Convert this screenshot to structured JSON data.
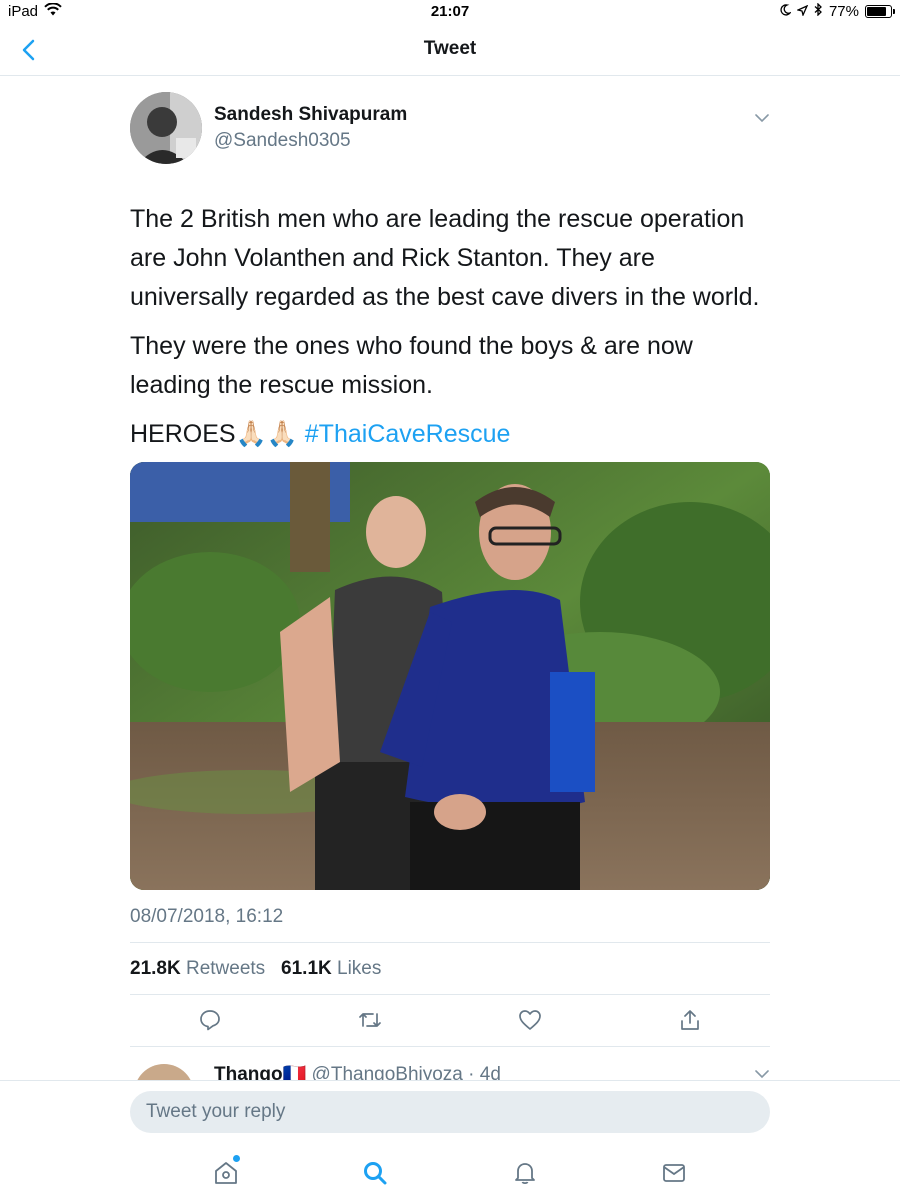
{
  "status_bar": {
    "device": "iPad",
    "time": "21:07",
    "battery": "77%",
    "battery_level": 0.77,
    "icons": [
      "wifi-icon",
      "moon-icon",
      "location-icon",
      "bluetooth-icon",
      "battery-icon"
    ]
  },
  "nav": {
    "title": "Tweet",
    "back_icon": "chevron-left-icon"
  },
  "tweet": {
    "author_name": "Sandesh Shivapuram",
    "author_handle": "@Sandesh0305",
    "text_p1": "The 2 British men who are leading the rescue operation are John Volanthen and Rick Stanton. They are universally regarded as the best cave divers in the world.",
    "text_p2": "They were the ones who found the boys & are now leading the rescue mission.",
    "text_p3_prefix": "HEROES🙏🏻🙏🏻 ",
    "hashtag": "#ThaiCaveRescue",
    "timestamp": "08/07/2018, 16:12",
    "retweet_count": "21.8K",
    "retweet_label": "Retweets",
    "like_count": "61.1K",
    "like_label": "Likes"
  },
  "reply_preview": {
    "name": "Thango🇫🇷",
    "handle_time": "@ThangoBhiyoza · 4d"
  },
  "compose": {
    "placeholder": "Tweet your reply"
  },
  "colors": {
    "accent": "#1da1f2",
    "text_primary": "#14171a",
    "text_secondary": "#657786",
    "divider": "#e1e8ed",
    "input_bg": "#e6ecf0"
  }
}
